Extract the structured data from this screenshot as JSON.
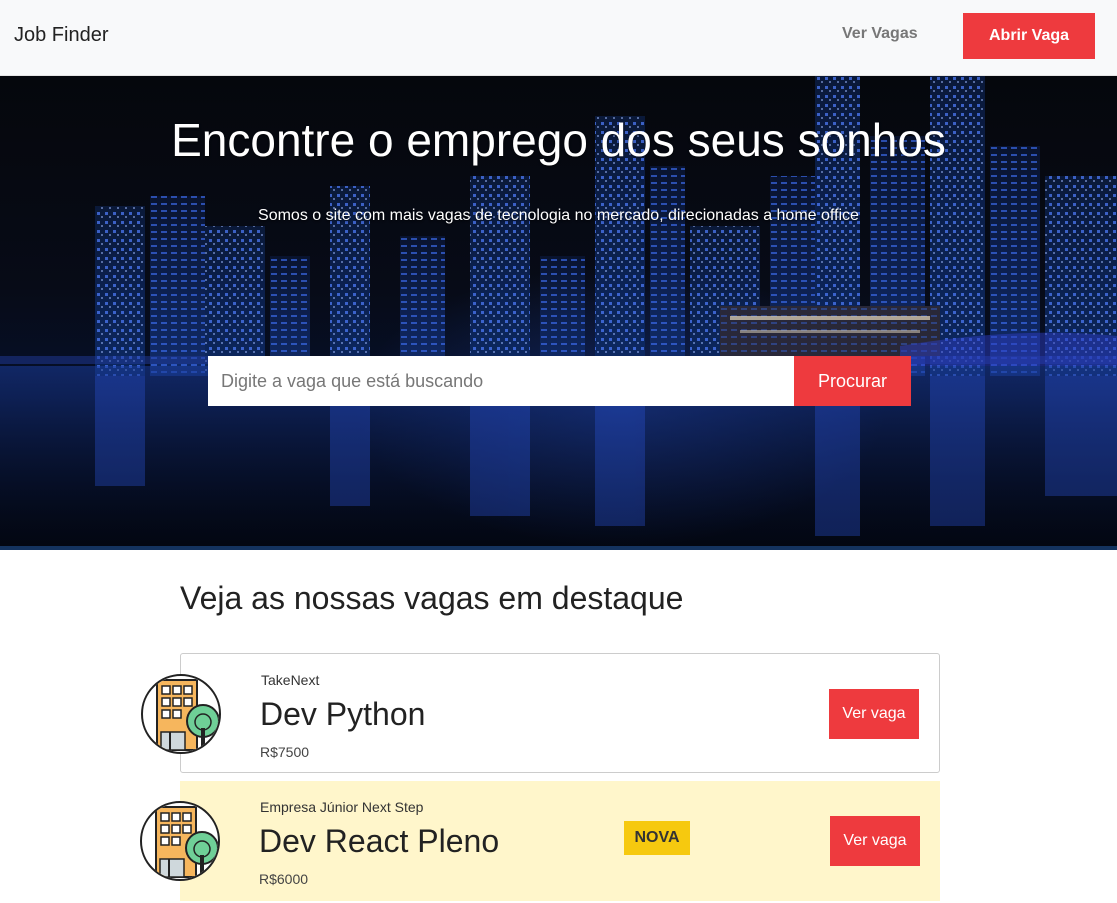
{
  "navbar": {
    "brand": "Job Finder",
    "link_label": "Ver Vagas",
    "cta_label": "Abrir Vaga"
  },
  "hero": {
    "title": "Encontre o emprego dos seus sonhos",
    "subtitle": "Somos o site com mais vagas de tecnologia no mercado, direcionadas a home office",
    "search_placeholder": "Digite a vaga que está buscando",
    "search_button": "Procurar"
  },
  "featured": {
    "title": "Veja as nossas vagas em destaque",
    "jobs": [
      {
        "company": "TakeNext",
        "title": "Dev Python",
        "salary": "R$7500",
        "button": "Ver vaga",
        "logo_icon": "building-tree-icon"
      },
      {
        "company": "Empresa Júnior Next Step",
        "title": "Dev React Pleno",
        "salary": "R$6000",
        "badge": "NOVA",
        "button": "Ver vaga",
        "logo_icon": "building-tree-icon"
      }
    ]
  },
  "colors": {
    "accent": "#ee3a3e",
    "badge": "#f6c90f",
    "new_job_background": "#fff6cb",
    "hero_border": "#14335f"
  }
}
